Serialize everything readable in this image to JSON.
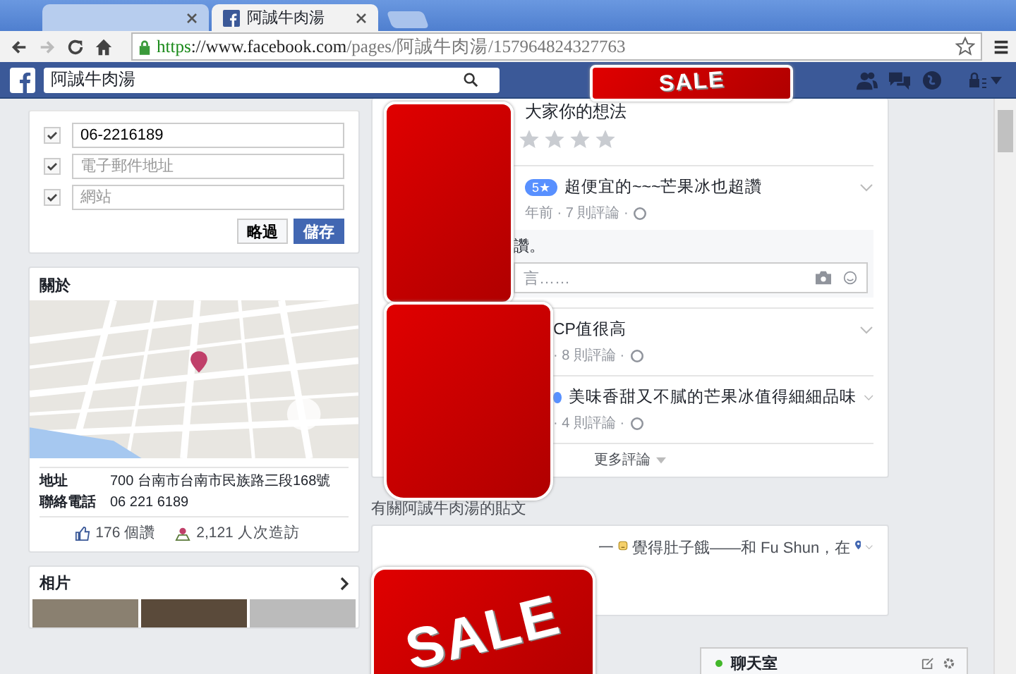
{
  "browser": {
    "tabs": [
      {
        "selected": false
      },
      {
        "title": "阿誠牛肉湯",
        "selected": true
      }
    ],
    "nav": {
      "forward_disabled": true
    },
    "url": {
      "scheme": "https",
      "host": "://www.facebook.com",
      "path": "/pages/阿誠牛肉湯/157964824327763"
    }
  },
  "topbar": {
    "search_value": "阿誠牛肉湯"
  },
  "stickers": [
    {
      "kind": "banner",
      "text": "SALE"
    },
    {
      "kind": "blank"
    },
    {
      "kind": "blank"
    },
    {
      "kind": "big",
      "text": "SALE"
    }
  ],
  "contact": {
    "rows": [
      {
        "checked": true,
        "value": "06-2216189"
      },
      {
        "checked": true,
        "placeholder": "電子郵件地址"
      },
      {
        "checked": true,
        "placeholder": "網站"
      }
    ],
    "buttons": [
      "略過",
      "儲存"
    ]
  },
  "about": {
    "title": "關於",
    "details": [
      {
        "label": "地址",
        "value": "700 台南市台南市民族路三段168號"
      },
      {
        "label": "聯絡電話",
        "value": "06 221 6189"
      }
    ],
    "likes": "176 個讚",
    "visits": "2,121 人次造訪"
  },
  "photos": {
    "title": "相片"
  },
  "reviews": {
    "prompt": "大家你的想法",
    "stars": 0,
    "items": [
      {
        "badge": "5★",
        "title": "超便宜的~~~芒果冰也超讚",
        "meta": "年前 · 7 則評論 ·",
        "comment": "讚。",
        "reply_placeholder": "言……"
      },
      {
        "title": "CP值很高",
        "meta": "· 8 則評論 ·"
      },
      {
        "dot": true,
        "title": "美味香甜又不膩的芒果冰值得細細品味",
        "meta": "· 4 則評論 ·"
      }
    ],
    "more": "更多評論"
  },
  "posts": {
    "heading": "有關阿誠牛肉湯的貼文",
    "items": [
      {
        "before": "一",
        "text": "覺得肚子餓——和 Fu Shun，在"
      }
    ]
  },
  "chat": {
    "title": "聊天室",
    "online": true
  }
}
